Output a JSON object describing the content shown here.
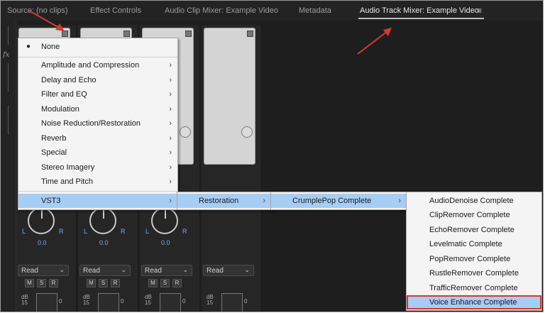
{
  "tabs": [
    {
      "label": "Source: (no clips)",
      "active": false
    },
    {
      "label": "Effect Controls",
      "active": false
    },
    {
      "label": "Audio Clip Mixer: Example Video",
      "active": false
    },
    {
      "label": "Metadata",
      "active": false
    },
    {
      "label": "Audio Track Mixer: Example Video",
      "active": true
    }
  ],
  "tab_menu_icon": "hamburger-icon",
  "fx_label": "fx",
  "channels": [
    {
      "pan_l": "L",
      "pan_r": "R",
      "pan_value": "0.0",
      "automation": "Read",
      "m": "M",
      "s": "S",
      "r": "R",
      "db_label": "dB",
      "db_scale": "15",
      "fader_zero": "0"
    },
    {
      "pan_l": "L",
      "pan_r": "R",
      "pan_value": "0.0",
      "automation": "Read",
      "m": "M",
      "s": "S",
      "r": "R",
      "db_label": "dB",
      "db_scale": "15",
      "fader_zero": "0"
    },
    {
      "pan_l": "L",
      "pan_r": "R",
      "pan_value": "0.0",
      "automation": "Read",
      "m": "M",
      "s": "S",
      "r": "R",
      "db_label": "dB",
      "db_scale": "15",
      "fader_zero": "0"
    },
    {
      "automation": "Read",
      "db_label": "dB",
      "db_scale": "15",
      "fader_zero": "0"
    }
  ],
  "effects_menu": {
    "none_label": "None",
    "items": [
      "Amplitude and Compression",
      "Delay and Echo",
      "Filter and EQ",
      "Modulation",
      "Noise Reduction/Restoration",
      "Reverb",
      "Special",
      "Stereo Imagery",
      "Time and Pitch"
    ],
    "vst3_label": "VST3"
  },
  "vst3_submenu": {
    "items": [
      "Restoration"
    ]
  },
  "restoration_submenu": {
    "items": [
      "CrumplePop Complete"
    ]
  },
  "crumplepop_submenu": {
    "items": [
      "AudioDenoise Complete",
      "ClipRemover Complete",
      "EchoRemover Complete",
      "Levelmatic Complete",
      "PopRemover Complete",
      "RustleRemover Complete",
      "TrafficRemover Complete",
      "Voice Enhance Complete"
    ],
    "selected": "Voice Enhance Complete"
  },
  "colors": {
    "highlight": "#a6cdf3",
    "annotation": "#d23b2a",
    "pan_text": "#7aa7ff"
  }
}
